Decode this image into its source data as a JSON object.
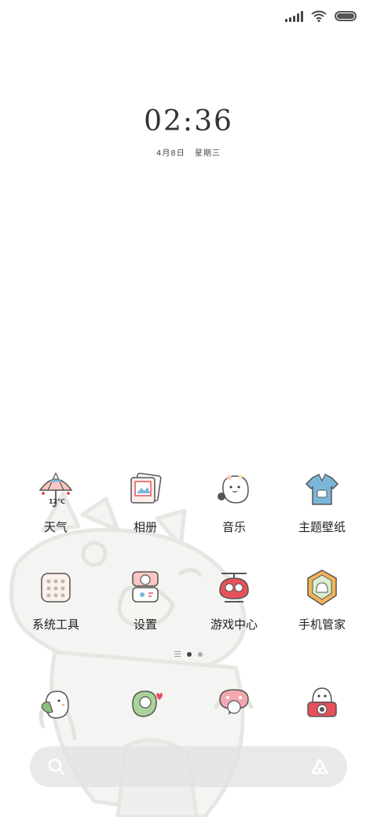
{
  "clock": {
    "time": "02:36",
    "date": "4月8日",
    "weekday": "星期三"
  },
  "apps_row1": [
    {
      "label": "天气",
      "temp": "12℃"
    },
    {
      "label": "相册"
    },
    {
      "label": "音乐"
    },
    {
      "label": "主题壁纸"
    }
  ],
  "apps_row2": [
    {
      "label": "系统工具"
    },
    {
      "label": "设置"
    },
    {
      "label": "游戏中心"
    },
    {
      "label": "手机管家"
    }
  ],
  "pager": {
    "current": 2,
    "total": 2
  },
  "colors": {
    "text": "#222222",
    "dock_bg": "#e1e1e1",
    "accent_red": "#e8515a",
    "accent_green": "#8cc07a"
  }
}
